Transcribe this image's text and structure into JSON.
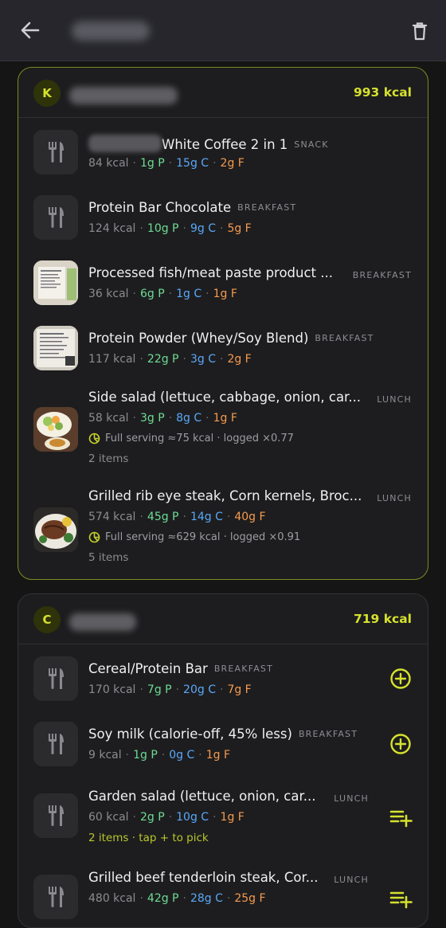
{
  "header": {
    "back_icon": "arrow-left-icon",
    "delete_icon": "trash-icon"
  },
  "groups": [
    {
      "avatar": "K",
      "total": "993 kcal",
      "items": [
        {
          "title": "White Coffee 2 in 1",
          "meal": "SNACK",
          "kcal": "84 kcal",
          "p": "1g P",
          "c": "15g C",
          "f": "2g F"
        },
        {
          "title": "Protein Bar Chocolate",
          "meal": "BREAKFAST",
          "kcal": "124 kcal",
          "p": "10g P",
          "c": "9g C",
          "f": "5g F"
        },
        {
          "title": "Processed fish/meat paste product ...",
          "meal": "BREAKFAST",
          "kcal": "36 kcal",
          "p": "6g P",
          "c": "1g C",
          "f": "1g F"
        },
        {
          "title": "Protein Powder (Whey/Soy Blend)",
          "meal": "BREAKFAST",
          "kcal": "117 kcal",
          "p": "22g P",
          "c": "3g C",
          "f": "2g F"
        },
        {
          "title": "Side salad (lettuce, cabbage, onion, car...",
          "meal": "LUNCH",
          "kcal": "58 kcal",
          "p": "3g P",
          "c": "8g C",
          "f": "1g F",
          "serving": "Full serving ≈75 kcal · logged ×0.77",
          "count": "2 items"
        },
        {
          "title": "Grilled rib eye steak, Corn kernels, Broc...",
          "meal": "LUNCH",
          "kcal": "574 kcal",
          "p": "45g P",
          "c": "14g C",
          "f": "40g F",
          "serving": "Full serving ≈629 kcal · logged ×0.91",
          "count": "5 items"
        }
      ]
    },
    {
      "avatar": "C",
      "total": "719 kcal",
      "items": [
        {
          "title": "Cereal/Protein Bar",
          "meal": "BREAKFAST",
          "kcal": "170 kcal",
          "p": "7g P",
          "c": "20g C",
          "f": "7g F"
        },
        {
          "title": "Soy milk (calorie-off, 45% less)",
          "meal": "BREAKFAST",
          "kcal": "9 kcal",
          "p": "1g P",
          "c": "0g C",
          "f": "1g F"
        },
        {
          "title": "Garden salad (lettuce, onion, car...",
          "meal": "LUNCH",
          "kcal": "60 kcal",
          "p": "2g P",
          "c": "10g C",
          "f": "1g F",
          "pick": "2 items · tap + to pick"
        },
        {
          "title": "Grilled beef tenderloin steak, Cor...",
          "meal": "LUNCH",
          "kcal": "480 kcal",
          "p": "42g P",
          "c": "28g C",
          "f": "25g F"
        }
      ]
    }
  ],
  "colors": {
    "accent": "#d6e12e",
    "protein": "#6ddc94",
    "carbs": "#5aa8f8",
    "fat": "#f59a4e"
  }
}
